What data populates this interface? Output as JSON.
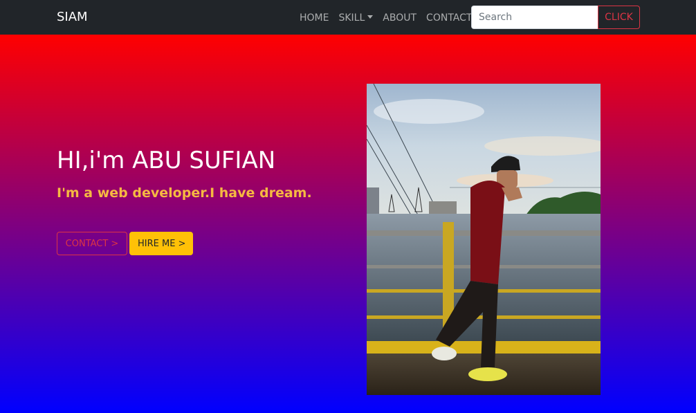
{
  "navbar": {
    "brand": "SIAM",
    "links": [
      {
        "label": "HOME"
      },
      {
        "label": "SKILL"
      },
      {
        "label": "ABOUT"
      },
      {
        "label": "CONTACT"
      }
    ],
    "search_placeholder": "Search",
    "search_value": "",
    "button_label": "CLICK"
  },
  "hero": {
    "headline": "HI,i'm ABU SUFIAN",
    "tagline": "I'm a web developer.I have dream.",
    "buttons": {
      "contact": "CONTACT >",
      "hire": "HIRE ME >"
    },
    "photo_description": "photo of a man in red t-shirt and cap walking on a bridge by a river"
  },
  "colors": {
    "navbar_bg": "#212529",
    "gradient_top": "#ff0000",
    "gradient_bottom": "#0000ff",
    "tagline": "#f5b942",
    "danger": "#dc3545",
    "warning": "#ffc107"
  }
}
